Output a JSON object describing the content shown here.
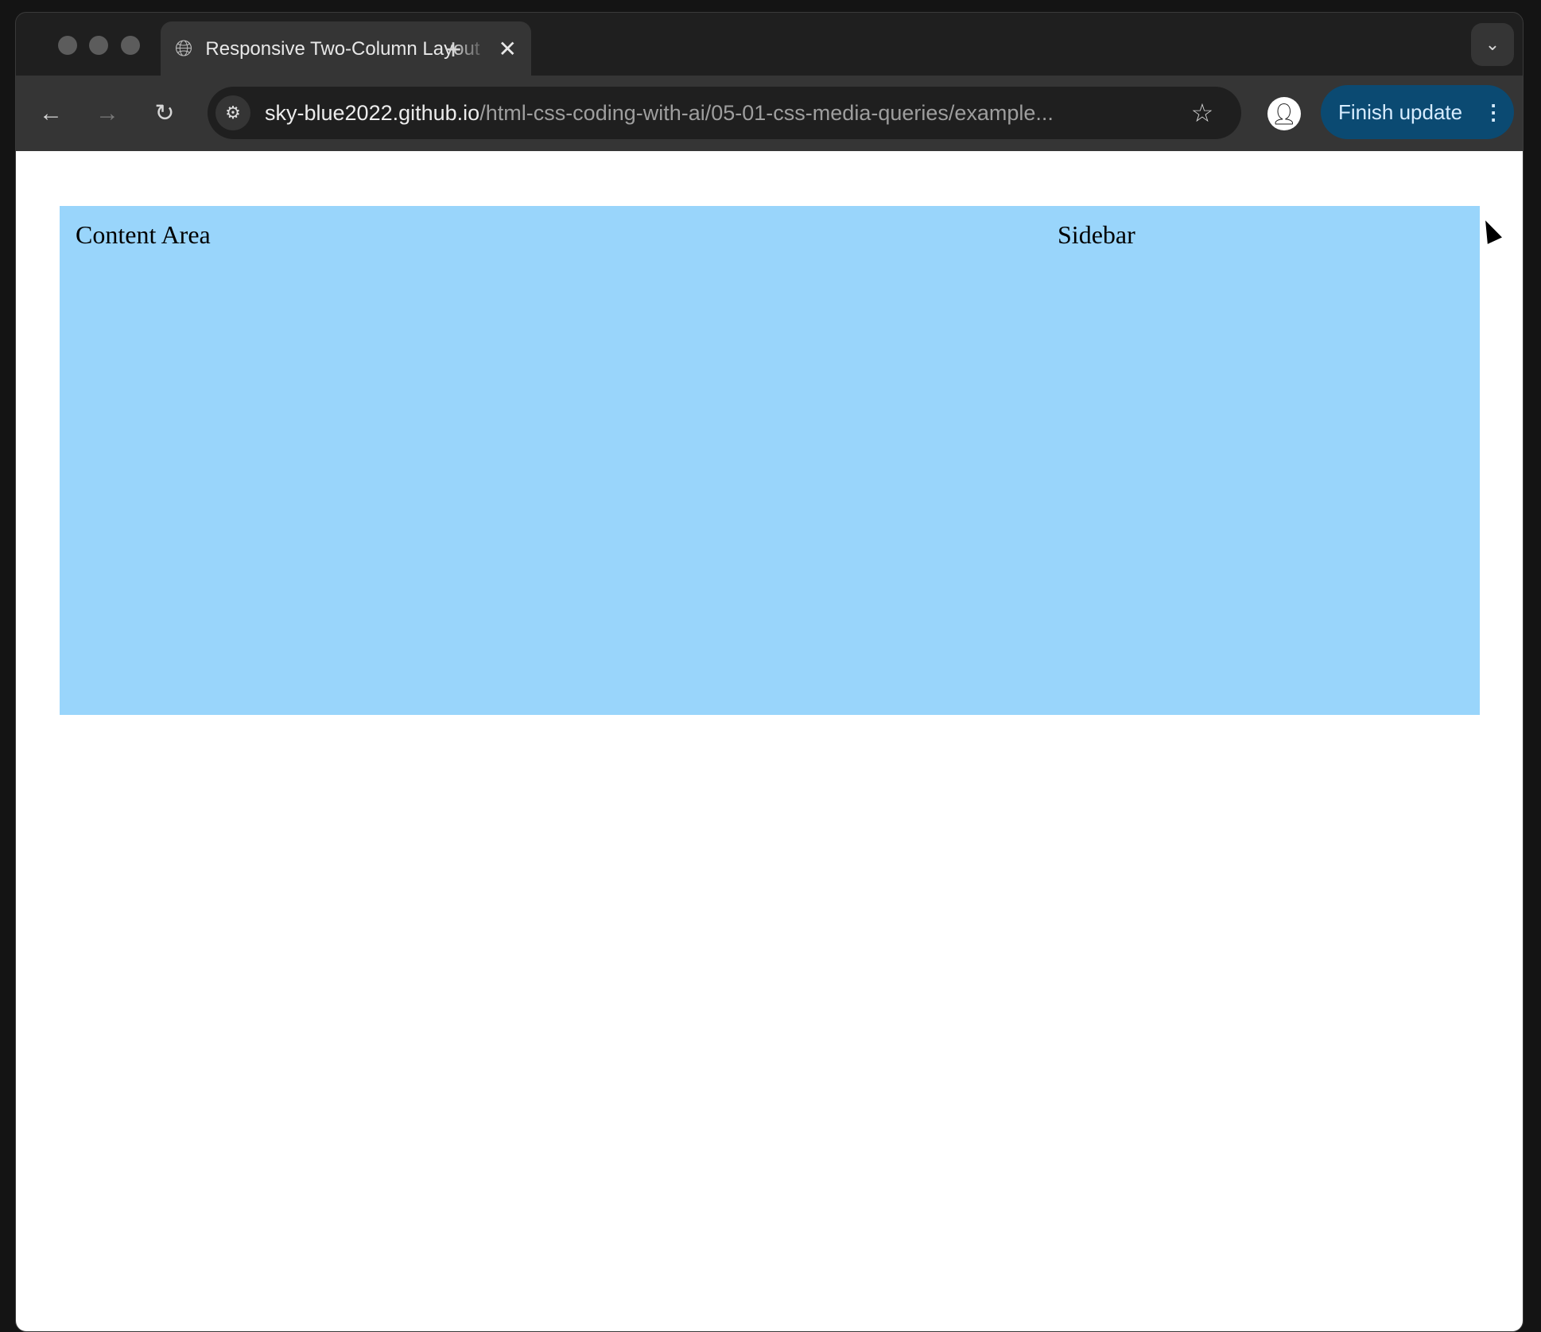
{
  "browser": {
    "tab": {
      "title": "Responsive Two-Column Layout",
      "favicon": "globe-icon"
    },
    "url": {
      "host": "sky-blue2022.github.io",
      "path": "/html-css-coding-with-ai/05-01-css-media-queries/example..."
    },
    "finish_update_label": "Finish update",
    "accent_color": "#0b4a72"
  },
  "page": {
    "content_label": "Content Area",
    "sidebar_label": "Sidebar",
    "background_color": "#99d5fb"
  }
}
